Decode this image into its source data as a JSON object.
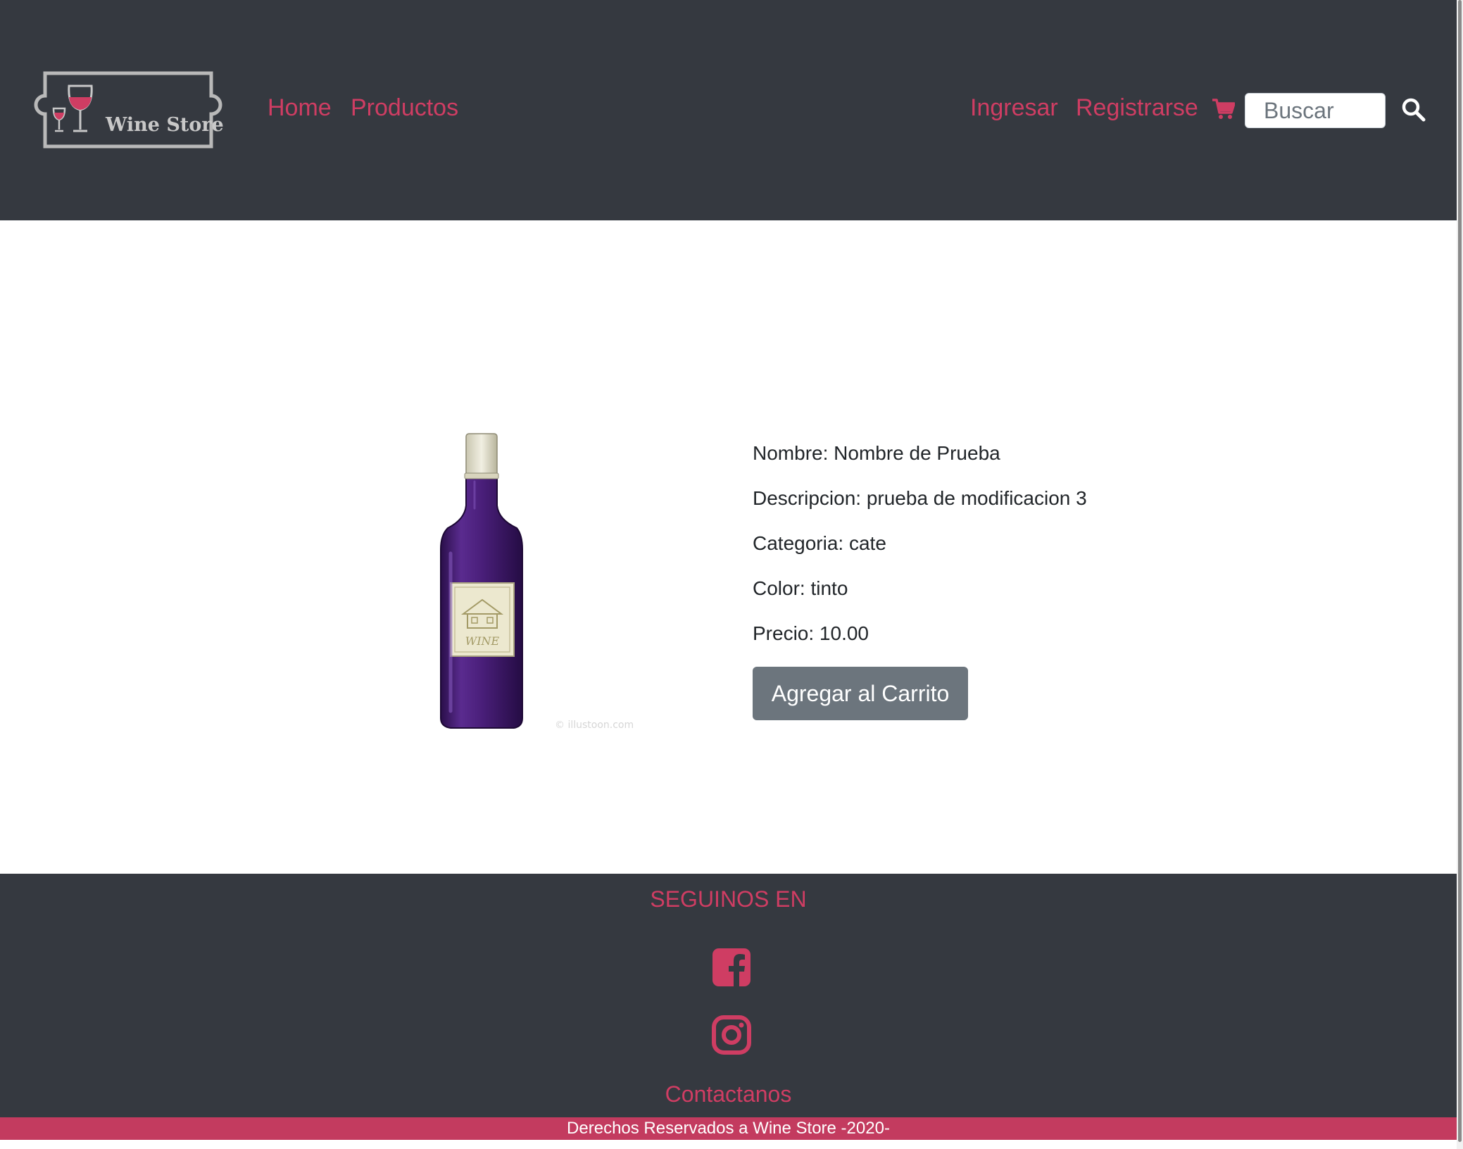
{
  "header": {
    "logo_text": "Wine Store",
    "nav": {
      "home": "Home",
      "products": "Productos",
      "login": "Ingresar",
      "register": "Registrarse"
    },
    "search_placeholder": "Buscar",
    "icons": {
      "cart": "shopping-cart-icon",
      "search": "search-icon"
    }
  },
  "product": {
    "name": "Nombre: Nombre de Prueba",
    "description": "Descripcion: prueba de modificacion 3",
    "category": "Categoria: cate",
    "color": "Color: tinto",
    "price": "Precio: 10.00",
    "add_to_cart_label": "Agregar al Carrito",
    "image_watermark": "© illustoon.com"
  },
  "footer": {
    "follow_title": "SEGUINOS EN",
    "social_icons": [
      "facebook-icon",
      "instagram-icon"
    ],
    "contact": "Contactanos",
    "copyright": "Derechos Reservados a Wine Store -2020-"
  },
  "colors": {
    "header_bg": "#353940",
    "accent": "#cf3d63",
    "copyright_bg": "#c33b5f",
    "button_bg": "#6c757d"
  }
}
